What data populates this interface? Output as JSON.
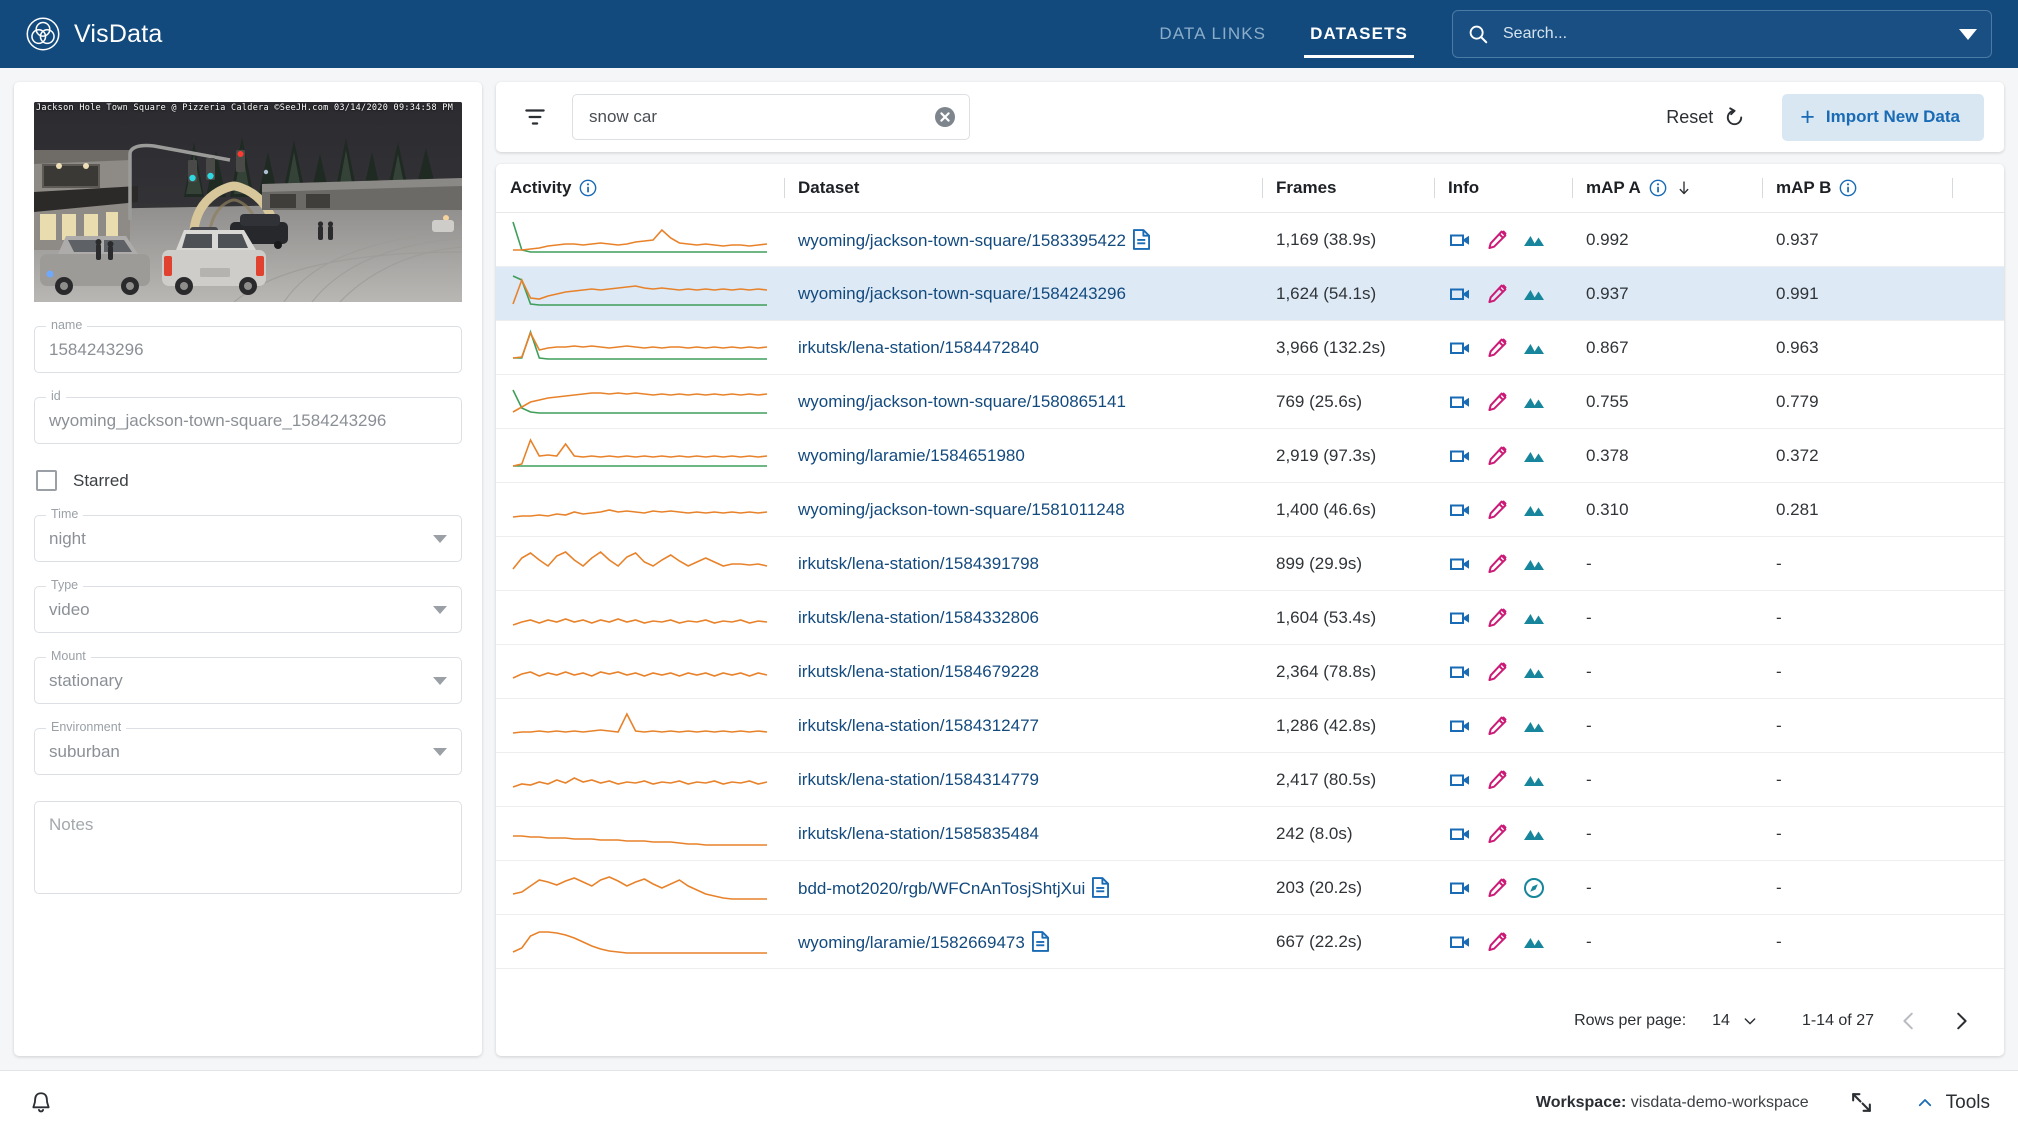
{
  "header": {
    "brand": "VisData",
    "logo_icon": "venn-circles-icon",
    "nav": [
      {
        "label": "DATA LINKS",
        "active": false
      },
      {
        "label": "DATASETS",
        "active": true
      }
    ],
    "search": {
      "placeholder": "Search...",
      "value": "",
      "icon": "search-icon",
      "dropdown_icon": "chevron-down-icon"
    },
    "bg_color": "#124a7e"
  },
  "sidebar": {
    "thumbnail": {
      "caption": "Jackson Hole Town Square @ Pizzeria Caldera ©SeeJH.com 03/14/2020 09:34:58 PM",
      "alt": "night-snow-street-webcam"
    },
    "fields": [
      {
        "label": "name",
        "value": "1584243296",
        "type": "text"
      },
      {
        "label": "id",
        "value": "wyoming_jackson-town-square_1584243296",
        "type": "text"
      }
    ],
    "checkbox": {
      "label": "Starred",
      "checked": false
    },
    "selects": [
      {
        "label": "Time",
        "value": "night"
      },
      {
        "label": "Type",
        "value": "video"
      },
      {
        "label": "Mount",
        "value": "stationary"
      },
      {
        "label": "Environment",
        "value": "suburban"
      }
    ],
    "notes": {
      "placeholder": "Notes",
      "value": ""
    }
  },
  "toolbar": {
    "filter_icon": "filter-icon",
    "search_value": "snow car",
    "clear_icon": "clear-circle-icon",
    "reset_label": "Reset",
    "reset_icon": "refresh-icon",
    "import_label": "Import New Data",
    "import_icon": "plus-icon"
  },
  "table": {
    "columns": [
      {
        "key": "activity",
        "label": "Activity",
        "info": true,
        "sort": null
      },
      {
        "key": "dataset",
        "label": "Dataset",
        "info": false,
        "sort": null
      },
      {
        "key": "frames",
        "label": "Frames",
        "info": false,
        "sort": null
      },
      {
        "key": "info",
        "label": "Info",
        "info": false,
        "sort": null
      },
      {
        "key": "mapa",
        "label": "mAP A",
        "info": true,
        "sort": "desc"
      },
      {
        "key": "mapb",
        "label": "mAP B",
        "info": true,
        "sort": null
      }
    ],
    "rows": [
      {
        "dataset": "wyoming/jackson-town-square/1583395422",
        "doc": true,
        "frames": "1,169 (38.9s)",
        "icons": [
          "videocam-icon",
          "edit-pencil-icon",
          "landscape-icon"
        ],
        "mapa": "0.992",
        "mapb": "0.937",
        "selected": false
      },
      {
        "dataset": "wyoming/jackson-town-square/1584243296",
        "doc": false,
        "frames": "1,624 (54.1s)",
        "icons": [
          "videocam-icon",
          "edit-pencil-icon",
          "landscape-icon"
        ],
        "mapa": "0.937",
        "mapb": "0.991",
        "selected": true
      },
      {
        "dataset": "irkutsk/lena-station/1584472840",
        "doc": false,
        "frames": "3,966 (132.2s)",
        "icons": [
          "videocam-icon",
          "edit-pencil-icon",
          "landscape-icon"
        ],
        "mapa": "0.867",
        "mapb": "0.963",
        "selected": false
      },
      {
        "dataset": "wyoming/jackson-town-square/1580865141",
        "doc": false,
        "frames": "769 (25.6s)",
        "icons": [
          "videocam-icon",
          "edit-pencil-icon",
          "landscape-icon"
        ],
        "mapa": "0.755",
        "mapb": "0.779",
        "selected": false
      },
      {
        "dataset": "wyoming/laramie/1584651980",
        "doc": false,
        "frames": "2,919 (97.3s)",
        "icons": [
          "videocam-icon",
          "edit-pencil-icon",
          "landscape-icon"
        ],
        "mapa": "0.378",
        "mapb": "0.372",
        "selected": false
      },
      {
        "dataset": "wyoming/jackson-town-square/1581011248",
        "doc": false,
        "frames": "1,400 (46.6s)",
        "icons": [
          "videocam-icon",
          "edit-pencil-icon",
          "landscape-icon"
        ],
        "mapa": "0.310",
        "mapb": "0.281",
        "selected": false
      },
      {
        "dataset": "irkutsk/lena-station/1584391798",
        "doc": false,
        "frames": "899 (29.9s)",
        "icons": [
          "videocam-icon",
          "edit-pencil-icon",
          "landscape-icon"
        ],
        "mapa": "-",
        "mapb": "-",
        "selected": false
      },
      {
        "dataset": "irkutsk/lena-station/1584332806",
        "doc": false,
        "frames": "1,604 (53.4s)",
        "icons": [
          "videocam-icon",
          "edit-pencil-icon",
          "landscape-icon"
        ],
        "mapa": "-",
        "mapb": "-",
        "selected": false
      },
      {
        "dataset": "irkutsk/lena-station/1584679228",
        "doc": false,
        "frames": "2,364 (78.8s)",
        "icons": [
          "videocam-icon",
          "edit-pencil-icon",
          "landscape-icon"
        ],
        "mapa": "-",
        "mapb": "-",
        "selected": false
      },
      {
        "dataset": "irkutsk/lena-station/1584312477",
        "doc": false,
        "frames": "1,286 (42.8s)",
        "icons": [
          "videocam-icon",
          "edit-pencil-icon",
          "landscape-icon"
        ],
        "mapa": "-",
        "mapb": "-",
        "selected": false
      },
      {
        "dataset": "irkutsk/lena-station/1584314779",
        "doc": false,
        "frames": "2,417 (80.5s)",
        "icons": [
          "videocam-icon",
          "edit-pencil-icon",
          "landscape-icon"
        ],
        "mapa": "-",
        "mapb": "-",
        "selected": false
      },
      {
        "dataset": "irkutsk/lena-station/1585835484",
        "doc": false,
        "frames": "242 (8.0s)",
        "icons": [
          "videocam-icon",
          "edit-pencil-icon",
          "landscape-icon"
        ],
        "mapa": "-",
        "mapb": "-",
        "selected": false
      },
      {
        "dataset": "bdd-mot2020/rgb/WFCnAnTosjShtjXui",
        "doc": true,
        "frames": "203 (20.2s)",
        "icons": [
          "videocam-icon",
          "edit-pencil-icon",
          "compass-icon"
        ],
        "mapa": "-",
        "mapb": "-",
        "selected": false
      },
      {
        "dataset": "wyoming/laramie/1582669473",
        "doc": true,
        "frames": "667 (22.2s)",
        "icons": [
          "videocam-icon",
          "edit-pencil-icon",
          "landscape-icon"
        ],
        "mapa": "-",
        "mapb": "-",
        "selected": false
      }
    ],
    "sparklines": [
      {
        "orange": [
          30,
          30,
          29,
          28,
          26,
          25,
          24,
          24,
          25,
          24,
          23,
          24,
          25,
          24,
          22,
          21,
          20,
          10,
          18,
          23,
          24,
          25,
          24,
          25,
          26,
          25,
          25,
          26,
          25,
          24
        ],
        "green": [
          2,
          30,
          32,
          32,
          32,
          32,
          32,
          32,
          32,
          32,
          32,
          32,
          32,
          32,
          32,
          32,
          32,
          32,
          32,
          32,
          32,
          32,
          32,
          32,
          32,
          32,
          32,
          32,
          32,
          32
        ]
      },
      {
        "orange": [
          30,
          6,
          24,
          25,
          22,
          20,
          18,
          17,
          16,
          15,
          16,
          15,
          14,
          13,
          12,
          14,
          15,
          14,
          15,
          16,
          15,
          16,
          15,
          16,
          15,
          16,
          15,
          16,
          15,
          16
        ],
        "green": [
          2,
          6,
          30,
          31,
          31,
          31,
          31,
          31,
          31,
          31,
          31,
          31,
          31,
          31,
          31,
          31,
          31,
          31,
          31,
          31,
          31,
          31,
          31,
          31,
          31,
          31,
          31,
          31,
          31,
          31
        ]
      },
      {
        "orange": [
          30,
          29,
          5,
          22,
          20,
          19,
          19,
          18,
          19,
          18,
          19,
          20,
          19,
          18,
          19,
          20,
          19,
          20,
          19,
          19,
          20,
          19,
          20,
          19,
          20,
          19,
          20,
          19,
          20,
          19
        ],
        "green": [
          30,
          30,
          4,
          30,
          31,
          31,
          31,
          31,
          31,
          31,
          31,
          31,
          31,
          31,
          31,
          31,
          31,
          31,
          31,
          31,
          31,
          31,
          31,
          31,
          31,
          31,
          31,
          31,
          31,
          31
        ]
      },
      {
        "orange": [
          30,
          25,
          20,
          18,
          16,
          15,
          14,
          13,
          12,
          11,
          11,
          12,
          11,
          12,
          11,
          12,
          13,
          12,
          13,
          12,
          13,
          12,
          13,
          12,
          13,
          12,
          13,
          12,
          13,
          12
        ],
        "green": [
          8,
          26,
          30,
          31,
          31,
          31,
          31,
          31,
          31,
          31,
          31,
          31,
          31,
          31,
          31,
          31,
          31,
          31,
          31,
          31,
          31,
          31,
          31,
          31,
          31,
          31,
          31,
          31,
          31,
          31
        ]
      },
      {
        "orange": [
          30,
          28,
          4,
          20,
          19,
          20,
          8,
          20,
          21,
          20,
          21,
          20,
          21,
          20,
          21,
          20,
          21,
          20,
          21,
          20,
          21,
          20,
          21,
          20,
          21,
          20,
          21,
          20,
          21,
          20
        ],
        "green": [
          30,
          30,
          30,
          30,
          30,
          30,
          30,
          30,
          30,
          30,
          30,
          30,
          30,
          30,
          30,
          30,
          30,
          30,
          30,
          30,
          30,
          30,
          30,
          30,
          30,
          30,
          30,
          30,
          30,
          30
        ]
      },
      {
        "orange": [
          27,
          26,
          26,
          25,
          26,
          24,
          25,
          22,
          24,
          23,
          22,
          20,
          22,
          21,
          22,
          23,
          21,
          22,
          21,
          22,
          23,
          22,
          23,
          22,
          23,
          22,
          23,
          22,
          23,
          22
        ],
        "green": null
      },
      {
        "orange": [
          25,
          14,
          9,
          16,
          22,
          12,
          8,
          16,
          22,
          14,
          8,
          16,
          22,
          13,
          9,
          18,
          22,
          16,
          11,
          17,
          22,
          18,
          14,
          18,
          22,
          20,
          20,
          21,
          20,
          22
        ],
        "green": null
      },
      {
        "orange": [
          27,
          24,
          22,
          25,
          22,
          24,
          21,
          24,
          22,
          25,
          22,
          24,
          21,
          24,
          22,
          25,
          23,
          24,
          22,
          25,
          23,
          24,
          22,
          25,
          23,
          24,
          22,
          25,
          23,
          24
        ],
        "green": null
      },
      {
        "orange": [
          26,
          22,
          20,
          24,
          21,
          23,
          20,
          23,
          21,
          24,
          20,
          22,
          20,
          23,
          21,
          24,
          21,
          23,
          21,
          24,
          21,
          23,
          21,
          24,
          21,
          23,
          21,
          24,
          21,
          23
        ],
        "green": null
      },
      {
        "orange": [
          27,
          26,
          26,
          25,
          26,
          25,
          26,
          25,
          26,
          25,
          24,
          25,
          26,
          8,
          25,
          26,
          25,
          26,
          25,
          26,
          25,
          26,
          25,
          26,
          25,
          26,
          25,
          26,
          25,
          26
        ],
        "green": null
      },
      {
        "orange": [
          27,
          24,
          25,
          22,
          24,
          20,
          23,
          18,
          22,
          20,
          23,
          21,
          24,
          22,
          23,
          21,
          24,
          22,
          23,
          21,
          24,
          22,
          23,
          21,
          24,
          22,
          23,
          21,
          24,
          22
        ],
        "green": null
      },
      {
        "orange": [
          22,
          22,
          23,
          23,
          24,
          24,
          24,
          25,
          25,
          25,
          26,
          26,
          26,
          27,
          27,
          27,
          28,
          28,
          28,
          29,
          30,
          30,
          31,
          31,
          31,
          31,
          31,
          31,
          31,
          31
        ],
        "green": null
      },
      {
        "orange": [
          26,
          24,
          18,
          12,
          14,
          17,
          13,
          10,
          14,
          18,
          12,
          9,
          13,
          18,
          14,
          11,
          16,
          20,
          16,
          12,
          18,
          22,
          26,
          28,
          30,
          31,
          31,
          31,
          31,
          31
        ],
        "green": null
      },
      {
        "orange": [
          30,
          26,
          14,
          10,
          10,
          11,
          13,
          16,
          20,
          24,
          27,
          29,
          30,
          31,
          31,
          31,
          31,
          31,
          31,
          31,
          31,
          31,
          31,
          31,
          31,
          31,
          31,
          31,
          31,
          31
        ],
        "green": null
      }
    ],
    "sparkline_colors": {
      "orange": "#e8822a",
      "green": "#3e9e5a"
    }
  },
  "pagination": {
    "rows_per_page_label": "Rows per page:",
    "rows_per_page_value": "14",
    "range_label": "1-14 of 27",
    "prev_icon": "chevron-left-icon",
    "next_icon": "chevron-right-icon"
  },
  "footer": {
    "bell_icon": "bell-icon",
    "workspace_label": "Workspace:",
    "workspace_value": "visdata-demo-workspace",
    "expand_icon": "expand-icon",
    "tools_label": "Tools",
    "tools_caret": "caret-up-icon"
  },
  "colors": {
    "brand_blue": "#124a7e",
    "link_blue": "#134a7e",
    "accent_blue": "#1a6bb5",
    "row_selected": "#dde9f5"
  }
}
